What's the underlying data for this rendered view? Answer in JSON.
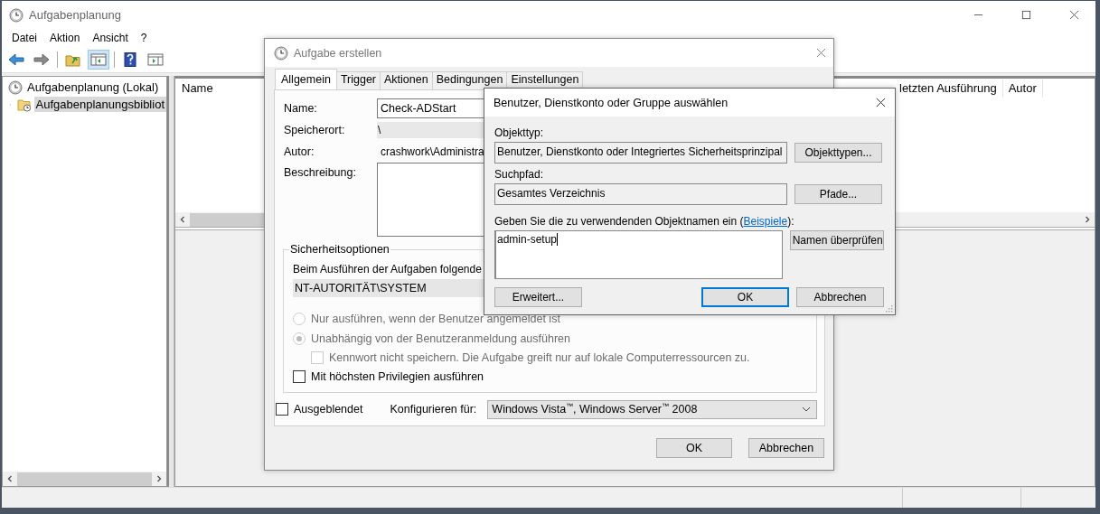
{
  "window": {
    "title": "Aufgabenplanung"
  },
  "menu": [
    "Datei",
    "Aktion",
    "Ansicht",
    "?"
  ],
  "tree": [
    {
      "label": "Aufgabenplanung (Lokal)",
      "selected": false,
      "children": [
        {
          "label": "Aufgabenplanungsbibliot",
          "selected": true,
          "expanded": false
        }
      ]
    }
  ],
  "task_list": {
    "columns": [
      "Name",
      "letzten Ausführung",
      "Autor"
    ]
  },
  "create_task_dialog": {
    "title": "Aufgabe erstellen",
    "tabs": [
      {
        "label": "Allgemein",
        "selected": true
      },
      {
        "label": "Trigger",
        "selected": false
      },
      {
        "label": "Aktionen",
        "selected": false
      },
      {
        "label": "Bedingungen",
        "selected": false
      },
      {
        "label": "Einstellungen",
        "selected": false
      }
    ],
    "fields": [
      {
        "kind": "input",
        "label": "Name:",
        "value": "Check-ADStart"
      },
      {
        "kind": "readonly",
        "label": "Speicherort:",
        "value": "\\"
      },
      {
        "kind": "text",
        "label": "Autor:",
        "value": "crashwork\\Administra"
      },
      {
        "kind": "textarea",
        "label": "Beschreibung:"
      }
    ],
    "security": {
      "legend": "Sicherheitsoptionen",
      "run_as_label": "Beim Ausführen der Aufgaben folgende",
      "account": "NT-AUTORITÄT\\SYSTEM",
      "options": [
        {
          "kind": "radio",
          "label": "Nur ausführen, wenn der Benutzer angemeldet ist",
          "selected": false,
          "disabled": true
        },
        {
          "kind": "radio",
          "label": "Unabhängig von der Benutzeranmeldung ausführen",
          "selected": true,
          "disabled": true,
          "children": [
            {
              "kind": "checkbox",
              "label": "Kennwort nicht speichern. Die Aufgabe greift nur auf lokale Computerressourcen zu.",
              "checked": false,
              "disabled": true
            }
          ]
        },
        {
          "kind": "checkbox",
          "label": "Mit höchsten Privilegien ausführen",
          "checked": false,
          "disabled": false
        }
      ]
    },
    "hidden": {
      "label": "Ausgeblendet",
      "checked": false
    },
    "configure": {
      "label": "Konfigurieren für:",
      "value": "Windows Vista$^{™}$, Windows Server$^{™}$ 2008"
    },
    "buttons": [
      "OK",
      "Abbrechen"
    ]
  },
  "select_user_dialog": {
    "title": "Benutzer, Dienstkonto oder Gruppe auswählen",
    "object_type": {
      "label": "Objekttyp:",
      "value": "Benutzer, Dienstkonto oder Integriertes Sicherheitsprinzipal",
      "button": "Objekttypen..."
    },
    "search_path": {
      "label": "Suchpfad:",
      "value": "Gesamtes Verzeichnis",
      "button": "Pfade..."
    },
    "names": {
      "label_before": "Geben Sie die zu verwendenden Objektnamen ein (",
      "link": "Beispiele",
      "label_after": "):",
      "value": "admin-setup",
      "button": "Namen überprüfen"
    },
    "buttons": [
      {
        "label": "Erweitert...",
        "default": false
      },
      {
        "label": "OK",
        "default": true
      },
      {
        "label": "Abbrechen",
        "default": false
      }
    ]
  }
}
